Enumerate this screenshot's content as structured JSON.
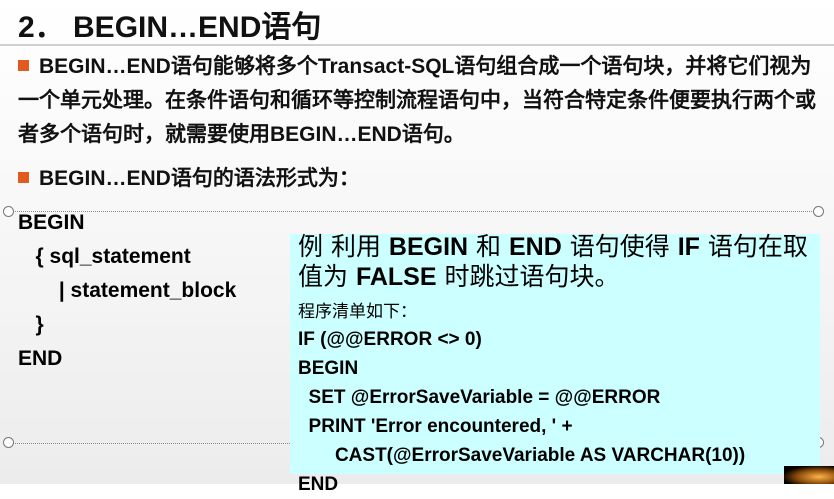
{
  "title": "2．  BEGIN…END语句",
  "bullets": [
    "BEGIN…END语句能够将多个Transact-SQL语句组合成一个语句块，并将它们视为一个单元处理。在条件语句和循环等控制流程语句中，当符合特定条件便要执行两个或者多个语句时，就需要使用BEGIN…END语句。",
    "BEGIN…END语句的语法形式为："
  ],
  "syntax": {
    "line1": "BEGIN",
    "line2": "   { sql_statement",
    "line3": "       | statement_block",
    "line4": "   }",
    "line5": "END"
  },
  "example": {
    "head_prefix": "例  利用 ",
    "kw_begin": "BEGIN",
    "head_and": " 和 ",
    "kw_end": "END",
    "head_mid": " 语句使得 ",
    "kw_if": "IF",
    "head_mid2": " 语句在取值为 ",
    "kw_false": "FALSE",
    "head_suffix": " 时跳过语句块。",
    "listing_label": "程序清单如下：",
    "code": [
      "IF (@@ERROR <> 0)",
      "BEGIN",
      "  SET @ErrorSaveVariable = @@ERROR",
      "  PRINT 'Error encountered, ' +",
      "       CAST(@ErrorSaveVariable AS VARCHAR(10))",
      "END"
    ]
  },
  "colors": {
    "bullet": "#e25a1f",
    "example_bg": "#ccffff"
  }
}
